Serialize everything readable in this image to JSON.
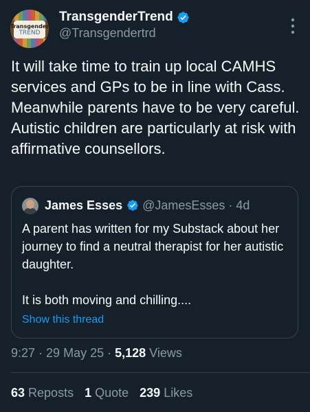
{
  "author": {
    "avatar_text_line1": "Transgender",
    "avatar_text_line2": "TREND",
    "display_name": "TransgenderTrend",
    "handle": "@Transgendertrd",
    "verified_icon": "verified-badge-icon"
  },
  "tweet": {
    "text": "It will take time to train up local CAMHS services and GPs to be in line with Cass. Meanwhile parents have to be very careful. Autistic children are particularly at risk with affirmative counsellors."
  },
  "quote": {
    "display_name": "James Esses",
    "handle": "@JamesEsses",
    "separator": "·",
    "time": "4d",
    "text": "A parent has written for my Substack about her journey to find a neutral therapist for her autistic daughter.\n\nIt is both moving and chilling....",
    "show_thread": "Show this thread"
  },
  "meta": {
    "time": "9:27",
    "sep1": " · ",
    "date": "29 May 25",
    "sep2": " · ",
    "views_count": "5,128",
    "views_label": " Views"
  },
  "stats": {
    "reposts_count": "63",
    "reposts_label": " Reposts",
    "quotes_count": "1",
    "quotes_label": " Quote",
    "likes_count": "239",
    "likes_label": " Likes"
  },
  "colors": {
    "background": "#15202b",
    "accent": "#1d9bf0",
    "secondary_text": "#8b98a5",
    "border": "#38444d"
  }
}
